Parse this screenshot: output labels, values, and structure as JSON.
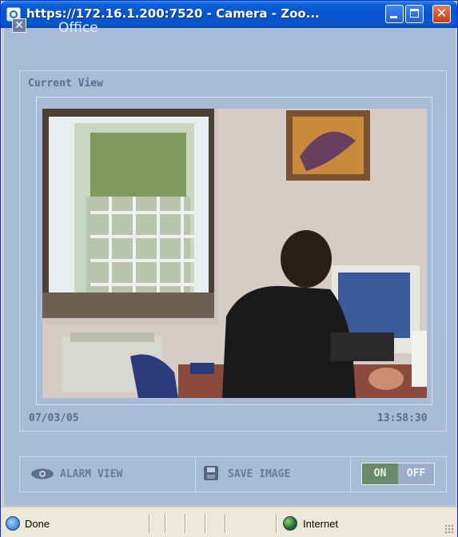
{
  "window": {
    "title": "https://172.16.1.200:7520 - Camera - Zoo...",
    "controls": {
      "minimize_icon": "minimize-icon",
      "maximize_icon": "maximize-icon",
      "close_icon": "close-icon"
    }
  },
  "header": {
    "close_glyph": "✕",
    "camera_name": "Office"
  },
  "panel": {
    "label": "Current View",
    "date": "07/03/05",
    "time": "13:58:30"
  },
  "toolbar": {
    "alarm_view_label": "ALARM VIEW",
    "save_image_label": "SAVE IMAGE",
    "toggle_on_label": "ON",
    "toggle_off_label": "OFF"
  },
  "statusbar": {
    "status_text": "Done",
    "zone_text": "Internet"
  },
  "colors": {
    "titlebar": "#0653cc",
    "panel_bg": "#a8bcd8",
    "toggle_on": "#6a8a6a",
    "toggle_off": "#9aaec8"
  }
}
